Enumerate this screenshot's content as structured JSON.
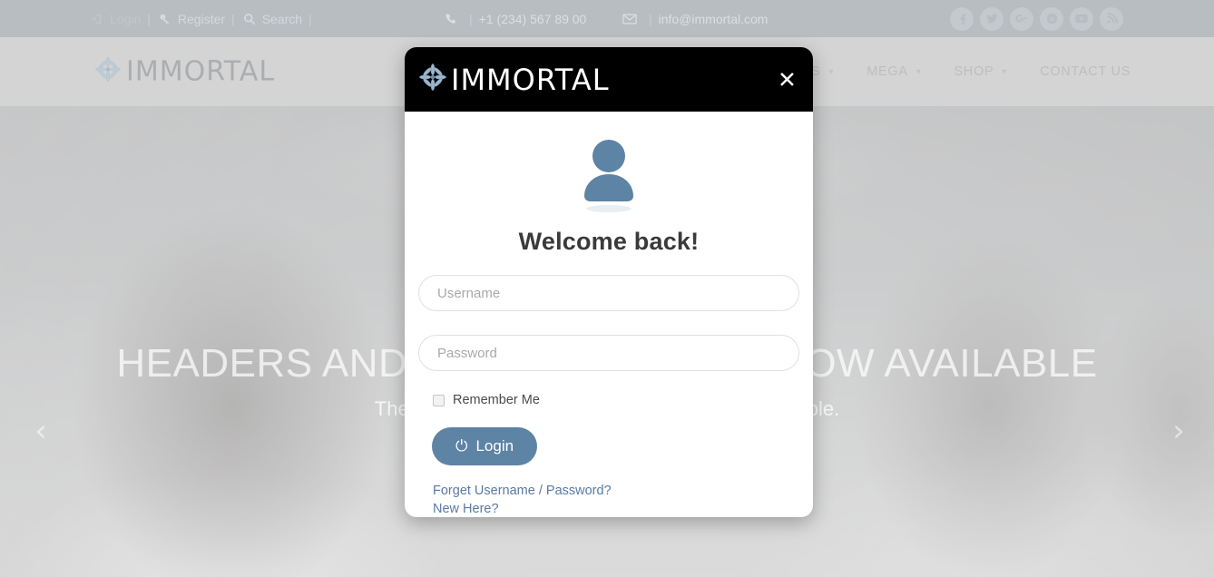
{
  "topbar": {
    "login": {
      "label": "Login",
      "icon": "sign-in-icon"
    },
    "register": {
      "label": "Register",
      "icon": "key-icon"
    },
    "search": {
      "label": "Search",
      "icon": "search-icon"
    },
    "separator": "|",
    "phone": {
      "number": "+1 (234) 567 89 00",
      "icon": "phone-icon"
    },
    "email": {
      "address": "info@immortal.com",
      "icon": "envelope-icon"
    },
    "socials": [
      {
        "name": "facebook-icon",
        "glyph": "f"
      },
      {
        "name": "twitter-icon",
        "glyph": "ᵗ"
      },
      {
        "name": "google-plus-icon",
        "glyph": "g+"
      },
      {
        "name": "skype-icon",
        "glyph": "s"
      },
      {
        "name": "youtube-icon",
        "glyph": "▶"
      },
      {
        "name": "rss-icon",
        "glyph": "◔"
      }
    ],
    "bg_color": "#868d96",
    "text_color": "#b9bfc6"
  },
  "navbar": {
    "logo": {
      "text": "IMMORTAL",
      "icon": "star-flower-icon",
      "icon_color": "#7d96ad"
    },
    "bg_color": "#b5b5b5",
    "links": [
      {
        "label": "S",
        "has_caret": true
      },
      {
        "label": "MEGA",
        "has_caret": true
      },
      {
        "label": "SHOP",
        "has_caret": true
      },
      {
        "label": "CONTACT US",
        "has_caret": false
      }
    ]
  },
  "hero": {
    "title": "HEADERS AND SLIDER LAYOUTS NOW AVAILABLE",
    "subtitle": "The new beautiful hand made CMS is now available.",
    "prev_arrow": "‹",
    "next_arrow": "›"
  },
  "modal": {
    "logo": {
      "text": "IMMORTAL",
      "icon": "star-flower-icon",
      "icon_color": "#8aa6c0"
    },
    "close_label": "✕",
    "avatar": {
      "icon": "user-avatar-icon",
      "color": "#5d83a5"
    },
    "heading": "Welcome back!",
    "username": {
      "placeholder": "Username",
      "value": ""
    },
    "password": {
      "placeholder": "Password",
      "value": ""
    },
    "remember": {
      "label": "Remember Me",
      "checked": false
    },
    "login_button": {
      "label": "Login",
      "icon": "power-icon",
      "glyph": "⏻",
      "color": "#5d83a5"
    },
    "links": [
      {
        "label": "Forget Username / Password?"
      },
      {
        "label": "New Here?"
      }
    ],
    "link_color": "#5b79a3",
    "header_bg": "#000000"
  }
}
